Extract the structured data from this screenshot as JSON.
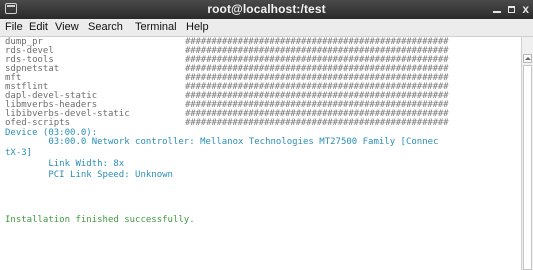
{
  "window": {
    "title": "root@localhost:/test",
    "controls": {
      "minimize": "_",
      "maximize": "□",
      "close": "x"
    }
  },
  "menu": {
    "items": [
      "File",
      "Edit",
      "View",
      "Search",
      "Terminal",
      "Help"
    ]
  },
  "terminal": {
    "package_rows": [
      {
        "name": "dump_pr",
        "progress": "##################################################"
      },
      {
        "name": "rds-devel",
        "progress": "##################################################"
      },
      {
        "name": "rds-tools",
        "progress": "##################################################"
      },
      {
        "name": "sdpnetstat",
        "progress": "##################################################"
      },
      {
        "name": "mft",
        "progress": "##################################################"
      },
      {
        "name": "mstflint",
        "progress": "##################################################"
      },
      {
        "name": "dapl-devel-static",
        "progress": "##################################################"
      },
      {
        "name": "libmverbs-headers",
        "progress": "##################################################"
      },
      {
        "name": "libibverbs-devel-static",
        "progress": "##################################################"
      },
      {
        "name": "ofed-scripts",
        "progress": "##################################################"
      }
    ],
    "device_header": "Device (03:00.0):",
    "device_line_1": "        03:00.0 Network controller: Mellanox Technologies MT27500 Family [Connec",
    "device_line_2": "tX-3]",
    "link_width": "        Link Width: 8x",
    "pci_speed": "        PCI Link Speed: Unknown",
    "install_message": "Installation finished successfully."
  },
  "colors": {
    "title_bar": "#2f2f2f",
    "menu_bar": "#ececec",
    "output_cyan": "#2a8fb6",
    "output_green": "#3f9b3f",
    "output_gray": "#6d6d6d"
  },
  "icons": {
    "window_icon": "terminal-window-icon",
    "scroll_up": "chevron-up-icon"
  }
}
